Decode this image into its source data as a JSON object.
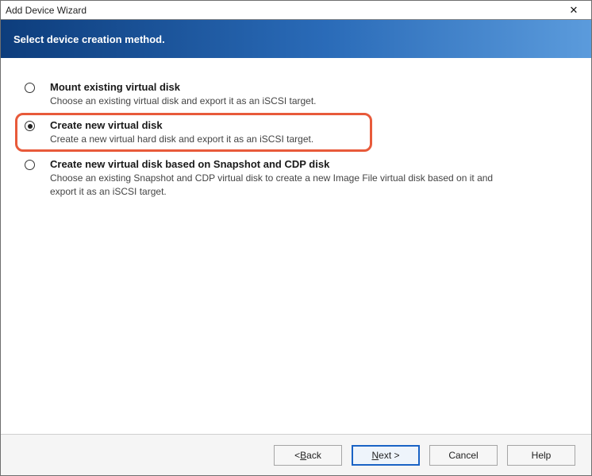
{
  "window": {
    "title": "Add Device Wizard",
    "close_symbol": "✕"
  },
  "banner": {
    "heading": "Select device creation method."
  },
  "options": [
    {
      "id": "mount",
      "title": "Mount existing virtual disk",
      "desc": "Choose an existing virtual disk and export it as an iSCSI target.",
      "selected": false
    },
    {
      "id": "create",
      "title": "Create new virtual disk",
      "desc": "Create a new virtual hard disk and export it as an iSCSI target.",
      "selected": true
    },
    {
      "id": "snapshot",
      "title": "Create new virtual disk based on Snapshot and CDP disk",
      "desc": "Choose an existing Snapshot and CDP virtual disk to create a new Image File virtual disk based on it and export it as an iSCSI target.",
      "selected": false
    }
  ],
  "highlight_option_index": 1,
  "footer": {
    "back_prefix": "< ",
    "back_hotkey": "B",
    "back_suffix": "ack",
    "next_hotkey": "N",
    "next_suffix": "ext >",
    "cancel": "Cancel",
    "help": "Help"
  }
}
